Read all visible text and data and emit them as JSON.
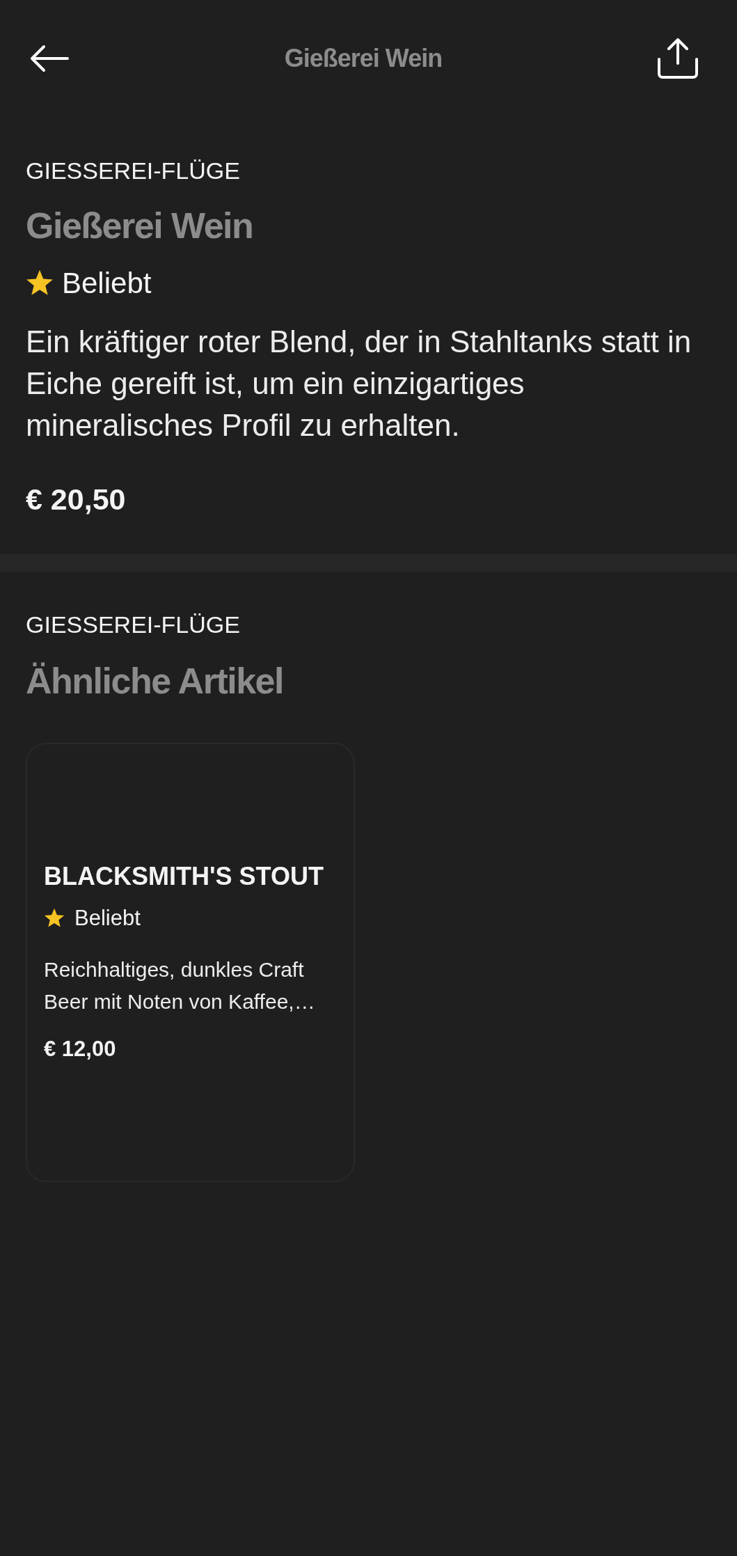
{
  "header": {
    "title": "Gießerei Wein"
  },
  "product": {
    "category": "GIESSEREI-FLÜGE",
    "name": "Gießerei Wein",
    "badge": "Beliebt",
    "description": "Ein kräftiger roter Blend, der in Stahltanks statt in Eiche gereift ist, um ein einzigartiges mineralisches Profil zu erhalten.",
    "price": "€ 20,50"
  },
  "similar": {
    "category": "GIESSEREI-FLÜGE",
    "title": "Ähnliche Artikel",
    "items": [
      {
        "name": "BLACKSMITH'S STOUT",
        "badge": "Beliebt",
        "description": "Reichhaltiges, dunkles Craft Beer mit Noten von Kaffee,…",
        "price": "€ 12,00"
      }
    ]
  }
}
